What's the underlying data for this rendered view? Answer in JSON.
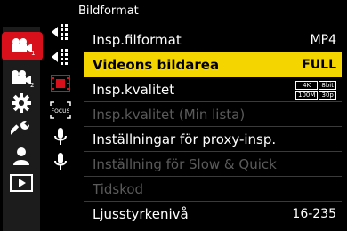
{
  "header": {
    "title": "Bildformat"
  },
  "tabs": [
    {
      "icon": "video-camera-1-icon",
      "badge": "1"
    },
    {
      "icon": "video-camera-2-icon",
      "badge": "2"
    },
    {
      "icon": "gear-icon"
    },
    {
      "icon": "wrench-icon"
    },
    {
      "icon": "person-icon"
    },
    {
      "icon": "playback-icon"
    }
  ],
  "subtabs": [
    {
      "icon": "arrow-frame-icon"
    },
    {
      "icon": "arrow-frame-icon"
    },
    {
      "icon": "film-strip-icon"
    },
    {
      "icon": "focus-icon",
      "label": "FOCUS"
    },
    {
      "icon": "microphone-icon"
    },
    {
      "icon": "microphone-icon"
    }
  ],
  "menu": [
    {
      "label": "Insp.filformat",
      "value": "MP4"
    },
    {
      "label": "Videons bildarea",
      "value": "FULL",
      "selected": true
    },
    {
      "label": "Insp.kvalitet",
      "value_badges": [
        "4K",
        "8bit",
        "100M",
        "30p"
      ]
    },
    {
      "label": "Insp.kvalitet (Min lista)",
      "disabled": true
    },
    {
      "label": "Inställningar för proxy-insp."
    },
    {
      "label": "Inställning för Slow & Quick",
      "disabled": true
    },
    {
      "label": "Tidskod",
      "disabled": true
    },
    {
      "label": "Ljusstyrkenivå",
      "value": "16-235"
    }
  ]
}
